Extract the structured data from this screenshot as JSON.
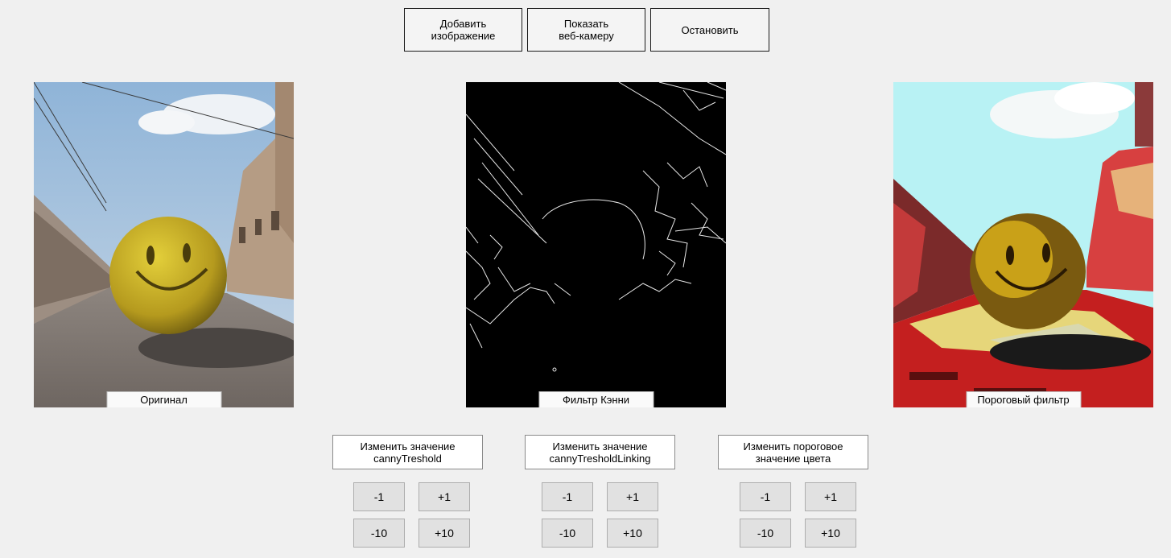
{
  "toolbar": {
    "add_image_line1": "Добавить",
    "add_image_line2": "изображение",
    "show_webcam_line1": "Показать",
    "show_webcam_line2": "веб-камеру",
    "stop": "Остановить"
  },
  "panels": {
    "original": "Оригинал",
    "canny": "Фильтр Кэнни",
    "threshold": "Пороговый фильтр"
  },
  "controls": [
    {
      "line1": "Изменить значение",
      "line2": "cannyTreshold",
      "minus1": "-1",
      "plus1": "+1",
      "minus10": "-10",
      "plus10": "+10"
    },
    {
      "line1": "Изменить значение",
      "line2": "cannyTresholdLinking",
      "minus1": "-1",
      "plus1": "+1",
      "minus10": "-10",
      "plus10": "+10"
    },
    {
      "line1": "Изменить пороговое",
      "line2": "значение цвета",
      "minus1": "-1",
      "plus1": "+1",
      "minus10": "-10",
      "plus10": "+10"
    }
  ]
}
